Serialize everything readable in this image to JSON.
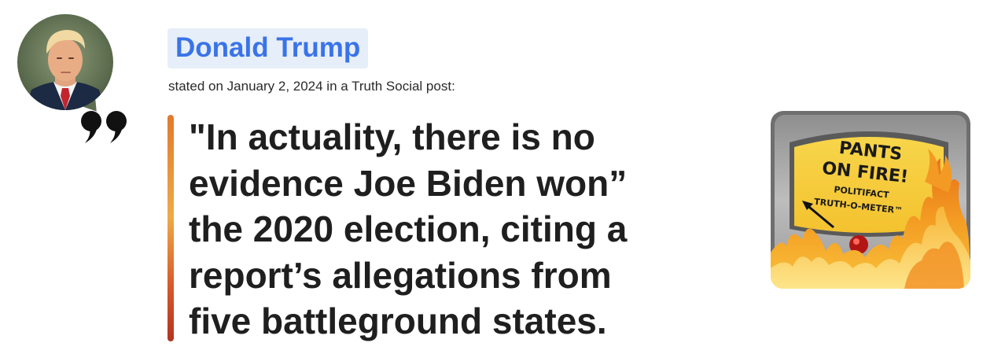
{
  "speaker": {
    "name": "Donald Trump"
  },
  "attribution": {
    "text": "stated on January 2, 2024 in a Truth Social post:"
  },
  "statement": {
    "lines": [
      "\"In actuality, there is no",
      "evidence Joe Biden won”",
      "the 2020 election, citing a",
      "report’s allegations from",
      "five battleground states."
    ]
  },
  "rating": {
    "line1": "PANTS",
    "line2": "ON FIRE!",
    "line3": "POLITIFACT",
    "line4": "TRUTH-O-METER™"
  },
  "colors": {
    "speaker_link": "#3a73e8",
    "speaker_bg": "#e6eef9",
    "statement_text": "#1f1f1f",
    "bar_top": "#e07a2e",
    "bar_bottom": "#b3341f"
  },
  "icons": {
    "avatar": "speaker-portrait",
    "quote": "quotation-mark-icon"
  }
}
